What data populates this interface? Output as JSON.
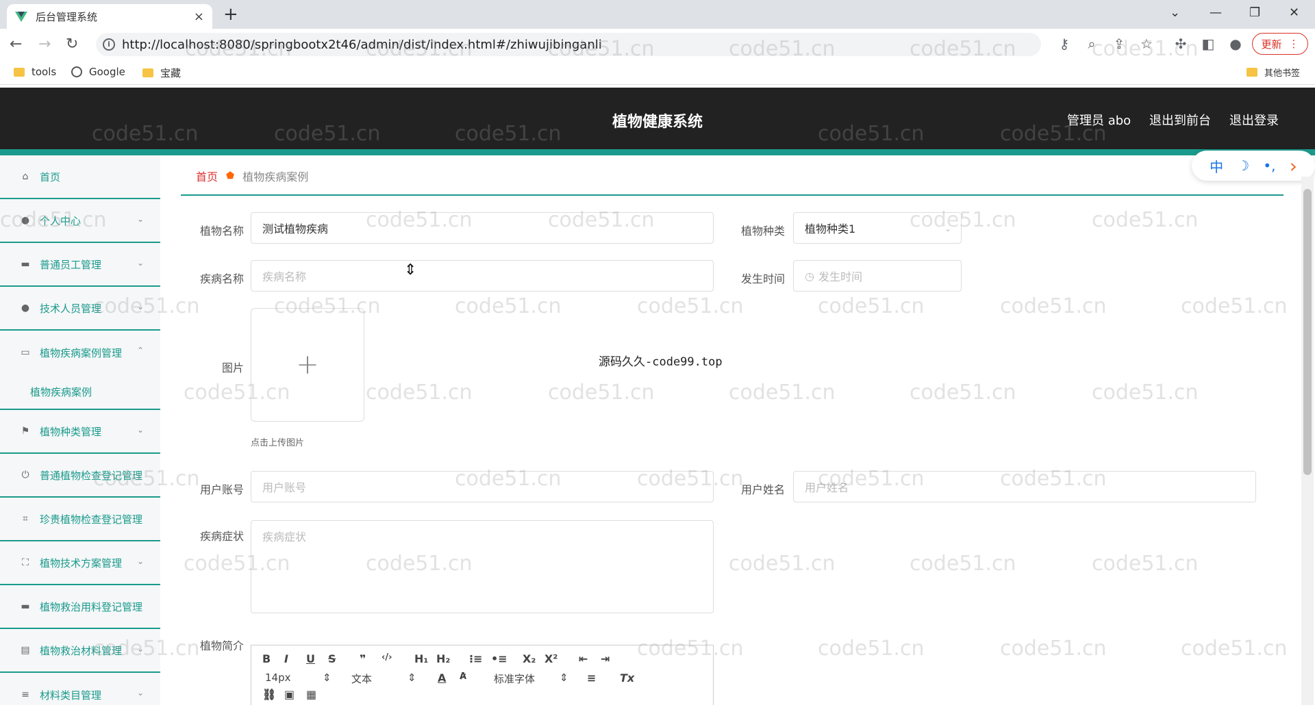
{
  "browser": {
    "tab_title": "后台管理系统",
    "tab_close": "×",
    "new_tab": "+",
    "url": "http://localhost:8080/springbootx2t46/admin/dist/index.html#/zhiwujibinganli",
    "update_label": "更新",
    "window_controls": [
      "⌄",
      "—",
      "❐",
      "✕"
    ],
    "bookmarks": [
      "tools",
      "Google",
      "宝藏"
    ],
    "other_bookmarks": "其他书签"
  },
  "header": {
    "title": "植物健康系统",
    "admin": "管理员 abo",
    "back_front": "退出到前台",
    "logout": "退出登录"
  },
  "sidebar": {
    "items": [
      {
        "label": "首页",
        "icon": "home-icon"
      },
      {
        "label": "个人中心",
        "icon": "user-icon"
      },
      {
        "label": "普通员工管理",
        "icon": "staff-icon"
      },
      {
        "label": "技术人员管理",
        "icon": "location-icon"
      },
      {
        "label": "植物疾病案例管理",
        "icon": "briefcase-icon"
      },
      {
        "label": "植物种类管理",
        "icon": "flag-icon"
      },
      {
        "label": "普通植物检查登记管理",
        "icon": "power-icon"
      },
      {
        "label": "珍贵植物检查登记管理",
        "icon": "crop-icon"
      },
      {
        "label": "植物技术方案管理",
        "icon": "fullscreen-icon"
      },
      {
        "label": "植物救治用料登记管理",
        "icon": "monitor-icon"
      },
      {
        "label": "植物救治材料管理",
        "icon": "document-icon"
      },
      {
        "label": "材料类目管理",
        "icon": "list-icon"
      }
    ],
    "submenu_active": "植物疾病案例"
  },
  "breadcrumb": {
    "home": "首页",
    "current": "植物疾病案例"
  },
  "float_toolbar": [
    "中",
    "☽",
    "•,",
    "›"
  ],
  "form": {
    "plant_name_label": "植物名称",
    "plant_name_value": "测试植物疾病",
    "plant_type_label": "植物种类",
    "plant_type_value": "植物种类1",
    "disease_name_label": "疾病名称",
    "disease_name_placeholder": "疾病名称",
    "occur_time_label": "发生时间",
    "occur_time_placeholder": "发生时间",
    "image_label": "图片",
    "upload_hint": "点击上传图片",
    "center_text": "源码久久-code99.top",
    "user_account_label": "用户账号",
    "user_account_placeholder": "用户账号",
    "user_name_label": "用户姓名",
    "user_name_placeholder": "用户姓名",
    "symptom_label": "疾病症状",
    "symptom_placeholder": "疾病症状",
    "intro_label": "植物简介"
  },
  "editor": {
    "font_size": "14px",
    "text_style": "文本",
    "font_family": "标准字体"
  },
  "watermark": "code51.cn"
}
